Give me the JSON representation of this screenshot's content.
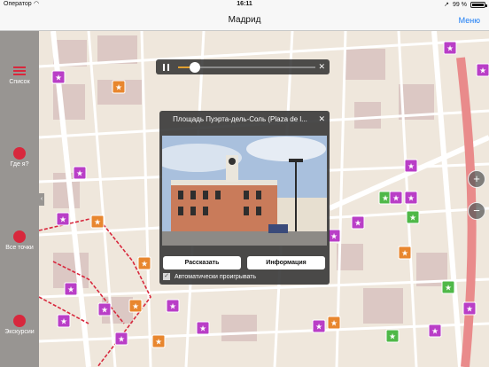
{
  "status": {
    "carrier": "Оператор",
    "time": "16:11",
    "battery": "99 %",
    "battery_level": 0.99
  },
  "nav": {
    "title": "Мадрид",
    "menu_label": "Меню"
  },
  "sidebar": {
    "items": [
      {
        "label": "Список",
        "icon": "list-icon"
      },
      {
        "label": "Где я?",
        "icon": "location-icon"
      },
      {
        "label": "Все точки",
        "icon": "all-points-icon"
      },
      {
        "label": "Экскурсии",
        "icon": "tours-icon"
      }
    ],
    "handle_glyph": "‹"
  },
  "player": {
    "progress": 0.12,
    "close_glyph": "✕"
  },
  "popup": {
    "title": "Площадь Пуэрта-дель-Соль (Plaza de l...",
    "close_glyph": "✕",
    "tell_button": "Рассказать",
    "info_button": "Информация",
    "autoplay_label": "Автоматически проигрывать",
    "autoplay_checked": true
  },
  "zoom": {
    "in": "+",
    "out": "−"
  },
  "colors": {
    "accent": "#1a7cf5",
    "marker_purple": "#b93ec7",
    "marker_orange": "#e8862e",
    "marker_green": "#4fb848",
    "route": "#d8283d"
  }
}
